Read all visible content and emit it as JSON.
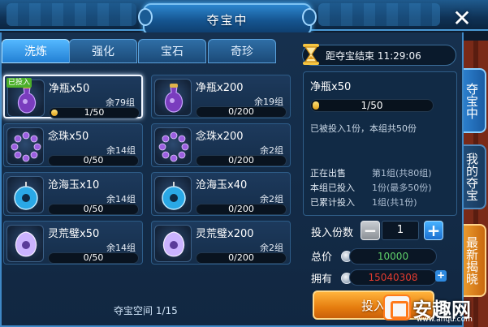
{
  "window": {
    "title": "夺宝中"
  },
  "tabs": [
    {
      "label": "洗炼",
      "active": true
    },
    {
      "label": "强化",
      "active": false
    },
    {
      "label": "宝石",
      "active": false
    },
    {
      "label": "奇珍",
      "active": false
    }
  ],
  "countdown": {
    "label": "距夺宝结束 11:29:06"
  },
  "items": [
    {
      "name": "净瓶x50",
      "remain": "余79组",
      "progress": "1/50",
      "fill": 0.02,
      "badge": "已投入",
      "icon": "purple-bottle-icon",
      "selected": true
    },
    {
      "name": "净瓶x200",
      "remain": "余19组",
      "progress": "0/200",
      "fill": 0,
      "icon": "purple-bottle-icon"
    },
    {
      "name": "念珠x50",
      "remain": "余14组",
      "progress": "0/50",
      "fill": 0,
      "icon": "prayer-beads-icon"
    },
    {
      "name": "念珠x200",
      "remain": "余2组",
      "progress": "0/200",
      "fill": 0,
      "icon": "prayer-beads-icon"
    },
    {
      "name": "沧海玉x10",
      "remain": "余14组",
      "progress": "0/50",
      "fill": 0,
      "icon": "jade-pendant-icon"
    },
    {
      "name": "沧海玉x40",
      "remain": "余2组",
      "progress": "0/200",
      "fill": 0,
      "icon": "jade-pendant-icon"
    },
    {
      "name": "灵荒璧x50",
      "remain": "余14组",
      "progress": "0/50",
      "fill": 0,
      "icon": "spirit-disc-icon"
    },
    {
      "name": "灵荒璧x200",
      "remain": "余2组",
      "progress": "0/200",
      "fill": 0,
      "icon": "spirit-disc-icon"
    }
  ],
  "detail": {
    "name": "净瓶x50",
    "progress": "1/50",
    "fill": 0.02,
    "note": "已被投入1份，本组共50份",
    "rows": [
      {
        "label": "正在出售",
        "value": "第1组(共80组)"
      },
      {
        "label": "本组已投入",
        "value": "1份(最多50份)"
      },
      {
        "label": "已累计投入",
        "value": "1组(共1份)"
      }
    ]
  },
  "invest": {
    "qty_label": "投入份数",
    "qty": "1",
    "total_label": "总价",
    "total": "10000",
    "own_label": "拥有",
    "own": "15040308",
    "button": "投入"
  },
  "footer": {
    "space": "夺宝空间 1/15"
  },
  "side_tabs": [
    {
      "label": "夺宝中",
      "active": true
    },
    {
      "label": "我的夺宝"
    },
    {
      "label": "最新揭晓"
    }
  ],
  "watermark": {
    "text": "安趣网",
    "url": "www.anqu.com"
  },
  "colors": {
    "accent": "#2380d4",
    "gold": "#e57c0e",
    "own_value": "#e23b2f",
    "total_value": "#5fd06a"
  }
}
